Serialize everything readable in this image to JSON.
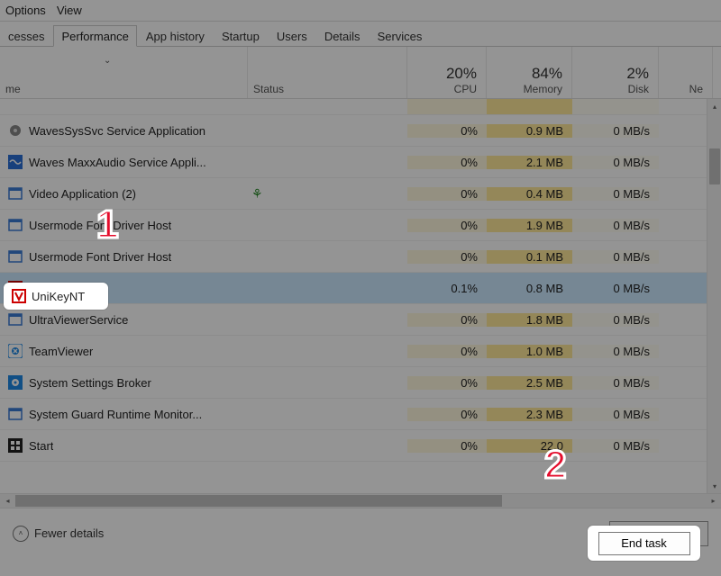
{
  "menubar": {
    "options": "Options",
    "view": "View"
  },
  "tabs": [
    "cesses",
    "Performance",
    "App history",
    "Startup",
    "Users",
    "Details",
    "Services"
  ],
  "active_tab_index": 0,
  "columns": {
    "name": "me",
    "status": "Status",
    "cpu": {
      "pct": "20%",
      "label": "CPU"
    },
    "memory": {
      "pct": "84%",
      "label": "Memory"
    },
    "disk": {
      "pct": "2%",
      "label": "Disk"
    },
    "network": {
      "label": "Ne"
    }
  },
  "processes": [
    {
      "name": "WavesSysSvc Service Application",
      "cpu": "0%",
      "mem": "0.9 MB",
      "disk": "0 MB/s",
      "selected": false,
      "icon": "gear"
    },
    {
      "name": "Waves MaxxAudio Service Appli...",
      "cpu": "0%",
      "mem": "2.1 MB",
      "disk": "0 MB/s",
      "selected": false,
      "icon": "waves"
    },
    {
      "name": "Video Application (2)",
      "cpu": "0%",
      "mem": "0.4 MB",
      "disk": "0 MB/s",
      "selected": false,
      "icon": "app",
      "efficient": true
    },
    {
      "name": "Usermode Font Driver Host",
      "cpu": "0%",
      "mem": "1.9 MB",
      "disk": "0 MB/s",
      "selected": false,
      "icon": "app"
    },
    {
      "name": "Usermode Font Driver Host",
      "cpu": "0%",
      "mem": "0.1 MB",
      "disk": "0 MB/s",
      "selected": false,
      "icon": "app"
    },
    {
      "name": "UniKeyNT",
      "cpu": "0.1%",
      "mem": "0.8 MB",
      "disk": "0 MB/s",
      "selected": true,
      "icon": "unikey"
    },
    {
      "name": "UltraViewerService",
      "cpu": "0%",
      "mem": "1.8 MB",
      "disk": "0 MB/s",
      "selected": false,
      "icon": "app"
    },
    {
      "name": "TeamViewer",
      "cpu": "0%",
      "mem": "1.0 MB",
      "disk": "0 MB/s",
      "selected": false,
      "icon": "team"
    },
    {
      "name": "System Settings Broker",
      "cpu": "0%",
      "mem": "2.5 MB",
      "disk": "0 MB/s",
      "selected": false,
      "icon": "gearblue"
    },
    {
      "name": "System Guard Runtime Monitor...",
      "cpu": "0%",
      "mem": "2.3 MB",
      "disk": "0 MB/s",
      "selected": false,
      "icon": "app"
    },
    {
      "name": "Start",
      "cpu": "0%",
      "mem": "22.0",
      "disk": "0 MB/s",
      "selected": false,
      "icon": "start"
    }
  ],
  "footer": {
    "fewer": "Fewer details",
    "endtask": "End task"
  },
  "annotations": {
    "one": "1",
    "two": "2"
  },
  "highlight_name": "UniKeyNT"
}
